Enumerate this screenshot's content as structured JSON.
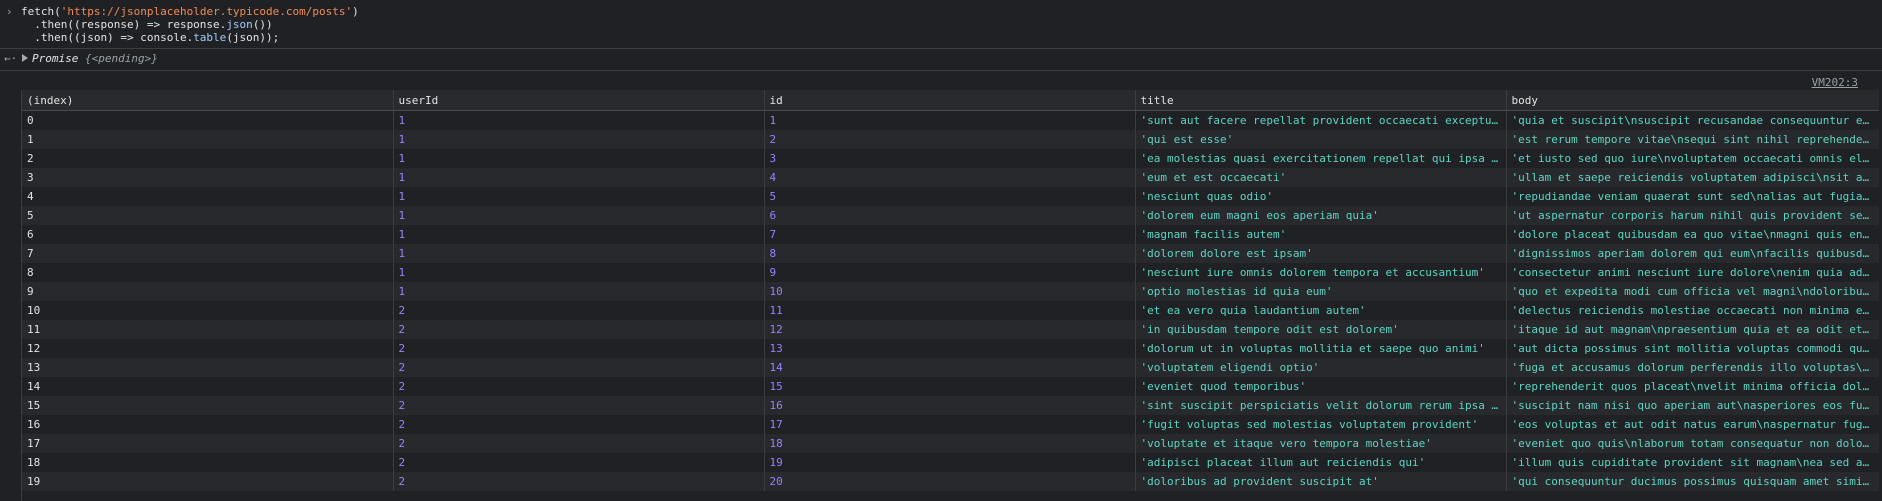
{
  "input": {
    "lines": [
      {
        "parts": [
          [
            "plain",
            "fetch("
          ],
          [
            "str",
            "'https://jsonplaceholder.typicode.com/posts'"
          ],
          [
            "plain",
            ")"
          ]
        ]
      },
      {
        "parts": [
          [
            "plain",
            "  .then((response) => response."
          ],
          [
            "fn",
            "json"
          ],
          [
            "plain",
            "())"
          ]
        ]
      },
      {
        "parts": [
          [
            "plain",
            "  .then((json) => console."
          ],
          [
            "fn",
            "table"
          ],
          [
            "plain",
            "(json));"
          ]
        ]
      }
    ]
  },
  "output": {
    "promise_label": "Promise",
    "promise_state": "{<pending>}"
  },
  "source_link": "VM202:3",
  "table": {
    "columns": [
      "(index)",
      "userId",
      "id",
      "title",
      "body"
    ],
    "rows": [
      [
        "0",
        "1",
        "1",
        "'sunt aut facere repellat provident occaecati excepturi optio reprehenderit'",
        "'quia et suscipit\\nsuscipit recusandae consequuntur expedita et cum'"
      ],
      [
        "1",
        "1",
        "2",
        "'qui est esse'",
        "'est rerum tempore vitae\\nsequi sint nihil reprehenderit dolor beatae'"
      ],
      [
        "2",
        "1",
        "3",
        "'ea molestias quasi exercitationem repellat qui ipsa sit aut'",
        "'et iusto sed quo iure\\nvoluptatem occaecati omnis eligendi aut ad'"
      ],
      [
        "3",
        "1",
        "4",
        "'eum et est occaecati'",
        "'ullam et saepe reiciendis voluptatem adipisci\\nsit amet autem'"
      ],
      [
        "4",
        "1",
        "5",
        "'nesciunt quas odio'",
        "'repudiandae veniam quaerat sunt sed\\nalias aut fugiat sit autem'"
      ],
      [
        "5",
        "1",
        "6",
        "'dolorem eum magni eos aperiam quia'",
        "'ut aspernatur corporis harum nihil quis provident sequi\\nmollitia'"
      ],
      [
        "6",
        "1",
        "7",
        "'magnam facilis autem'",
        "'dolore placeat quibusdam ea quo vitae\\nmagni quis enim qui quis'"
      ],
      [
        "7",
        "1",
        "8",
        "'dolorem dolore est ipsam'",
        "'dignissimos aperiam dolorem qui eum\\nfacilis quibusdam animi sint'"
      ],
      [
        "8",
        "1",
        "9",
        "'nesciunt iure omnis dolorem tempora et accusantium'",
        "'consectetur animi nesciunt iure dolore\\nenim quia ad\\nveniam autem'"
      ],
      [
        "9",
        "1",
        "10",
        "'optio molestias id quia eum'",
        "'quo et expedita modi cum officia vel magni\\ndoloribus qui repudiandae'"
      ],
      [
        "10",
        "2",
        "11",
        "'et ea vero quia laudantium autem'",
        "'delectus reiciendis molestiae occaecati non minima eveniet qui voluptatibus'"
      ],
      [
        "11",
        "2",
        "12",
        "'in quibusdam tempore odit est dolorem'",
        "'itaque id aut magnam\\npraesentium quia et ea odit et ea voluptas et'"
      ],
      [
        "12",
        "2",
        "13",
        "'dolorum ut in voluptas mollitia et saepe quo animi'",
        "'aut dicta possimus sint mollitia voluptas commodi quo doloremque'"
      ],
      [
        "13",
        "2",
        "14",
        "'voluptatem eligendi optio'",
        "'fuga et accusamus dolorum perferendis illo voluptas\\nnon doloremque'"
      ],
      [
        "14",
        "2",
        "15",
        "'eveniet quod temporibus'",
        "'reprehenderit quos placeat\\nvelit minima officia dolores impedit'"
      ],
      [
        "15",
        "2",
        "16",
        "'sint suscipit perspiciatis velit dolorum rerum ipsa laboriosam odio'",
        "'suscipit nam nisi quo aperiam aut\\nasperiores eos fugit maiores'"
      ],
      [
        "16",
        "2",
        "17",
        "'fugit voluptas sed molestias voluptatem provident'",
        "'eos voluptas et aut odit natus earum\\naspernatur fuga molestiae'"
      ],
      [
        "17",
        "2",
        "18",
        "'voluptate et itaque vero tempora molestiae'",
        "'eveniet quo quis\\nlaborum totam consequatur non dolor\\nut et est'"
      ],
      [
        "18",
        "2",
        "19",
        "'adipisci placeat illum aut reiciendis qui'",
        "'illum quis cupiditate provident sit magnam\\nea sed aut omnis'"
      ],
      [
        "19",
        "2",
        "20",
        "'doloribus ad provident suscipit at'",
        "'qui consequuntur ducimus possimus quisquam amet similique'"
      ]
    ]
  }
}
